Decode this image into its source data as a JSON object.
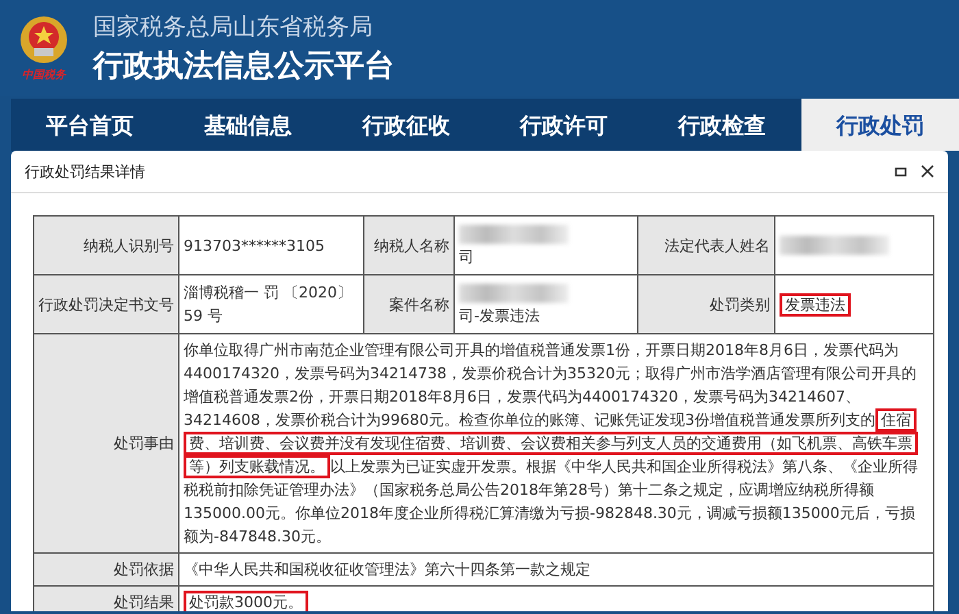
{
  "header": {
    "subtitle": "国家税务总局山东省税务局",
    "title": "行政执法信息公示平台",
    "logo_caption": "中国税务"
  },
  "tabs": [
    {
      "label": "平台首页",
      "selected": false
    },
    {
      "label": "基础信息",
      "selected": false
    },
    {
      "label": "行政征收",
      "selected": false
    },
    {
      "label": "行政许可",
      "selected": false
    },
    {
      "label": "行政检查",
      "selected": false
    },
    {
      "label": "行政处罚",
      "selected": true
    }
  ],
  "dialog": {
    "title": "行政处罚结果详情",
    "rows": [
      {
        "kind": "triple",
        "cells": [
          {
            "label": "纳税人识别号",
            "value": "913703******3105",
            "redacted": false,
            "highlighted": false
          },
          {
            "label": "纳税人名称",
            "value": "司",
            "redacted": true,
            "highlighted": false
          },
          {
            "label": "法定代表人姓名",
            "redacted": true
          }
        ]
      },
      {
        "kind": "triple",
        "cells": [
          {
            "label": "行政处罚决定书文号",
            "value": "淄博税稽一 罚 〔2020〕59 号",
            "redacted": false,
            "highlighted": false
          },
          {
            "label": "案件名称",
            "value": "司-发票违法",
            "redacted": true,
            "highlighted": false
          },
          {
            "label": "处罚类别",
            "value": "发票违法",
            "redacted": false,
            "highlighted": true
          }
        ]
      },
      {
        "kind": "wide",
        "label": "处罚事由",
        "segments": [
          {
            "text": "你单位取得广州市南范企业管理有限公司开具的增值税普通发票1份，开票日期2018年8月6日，发票代码为4400174320，发票号码为34214738，发票价税合计为35320元；取得广州市浩学酒店管理有限公司开具的增值税普通发票2份，开票日期2018年8月6日，发票代码为4400174320，发票号码为34214607、34214608，发票价税合计为99680元。检查你单位的账簿、记账凭证发现3份增值税普通发票所列支的",
            "highlighted": false
          },
          {
            "text": "住宿费、培训费、会议费并没有发现住宿费、培训费、会议费相关参与列支人员的交通费用（如飞机票、高铁车票等）列支账载情况。",
            "highlighted": true
          },
          {
            "text": "以上发票为已证实虚开发票。根据《中华人民共和国企业所得税法》第八条、《企业所得税税前扣除凭证管理办法》（国家税务总局公告2018年第28号）第十二条之规定，应调增应纳税所得额135000.00元。你单位2018年度企业所得税汇算清缴为亏损-982848.30元，调减亏损额135000元后，亏损额为-847848.30元。",
            "highlighted": false
          }
        ]
      },
      {
        "kind": "wide",
        "label": "处罚依据",
        "segments": [
          {
            "text": "《中华人民共和国税收征收管理法》第六十四条第一款之规定",
            "highlighted": false
          }
        ]
      },
      {
        "kind": "wide",
        "label": "处罚结果",
        "segments": [
          {
            "text": "处罚款3000元。",
            "highlighted": true
          }
        ]
      }
    ]
  }
}
